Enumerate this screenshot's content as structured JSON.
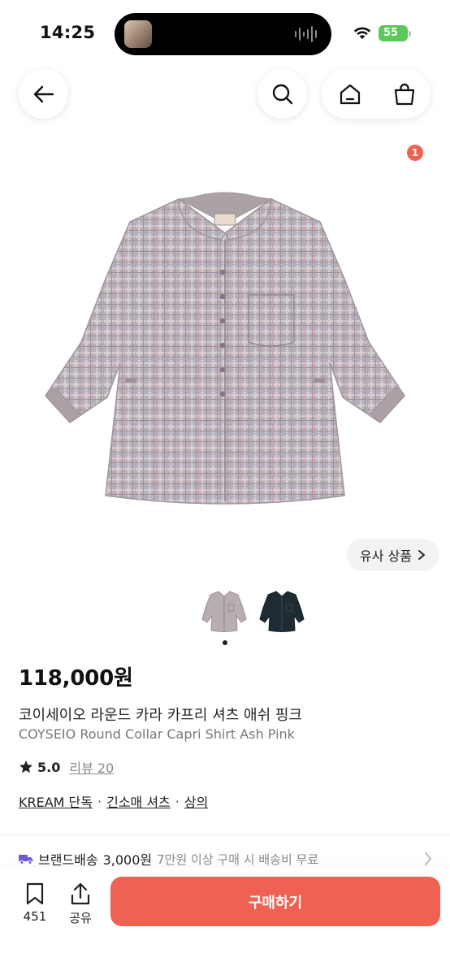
{
  "status_bar": {
    "time": "14:25",
    "battery": "55"
  },
  "header": {
    "cart_count": "1"
  },
  "product": {
    "similar_label": "유사 상품",
    "price": "118,000원",
    "name_ko": "코이세이오 라운드 카라 카프리 셔츠 애쉬 핑크",
    "name_en": "COYSEIO Round Collar Capri Shirt Ash Pink",
    "rating": "5.0",
    "review_label": "리뷰 20",
    "tags": [
      "KREAM 단독",
      "긴소매 셔츠",
      "상의"
    ],
    "tag_separator": "·",
    "colors": {
      "ash_pink": "#b7adb2",
      "navy": "#1f2b33"
    }
  },
  "shipping": {
    "label": "브랜드배송",
    "price": "3,000원",
    "note": "7만원 이상 구매 시 배송비 무료",
    "accent": "#6b5bd9"
  },
  "bottom_bar": {
    "bookmark_count": "451",
    "share_label": "공유",
    "buy_label": "구매하기",
    "buy_color": "#ef6253"
  }
}
